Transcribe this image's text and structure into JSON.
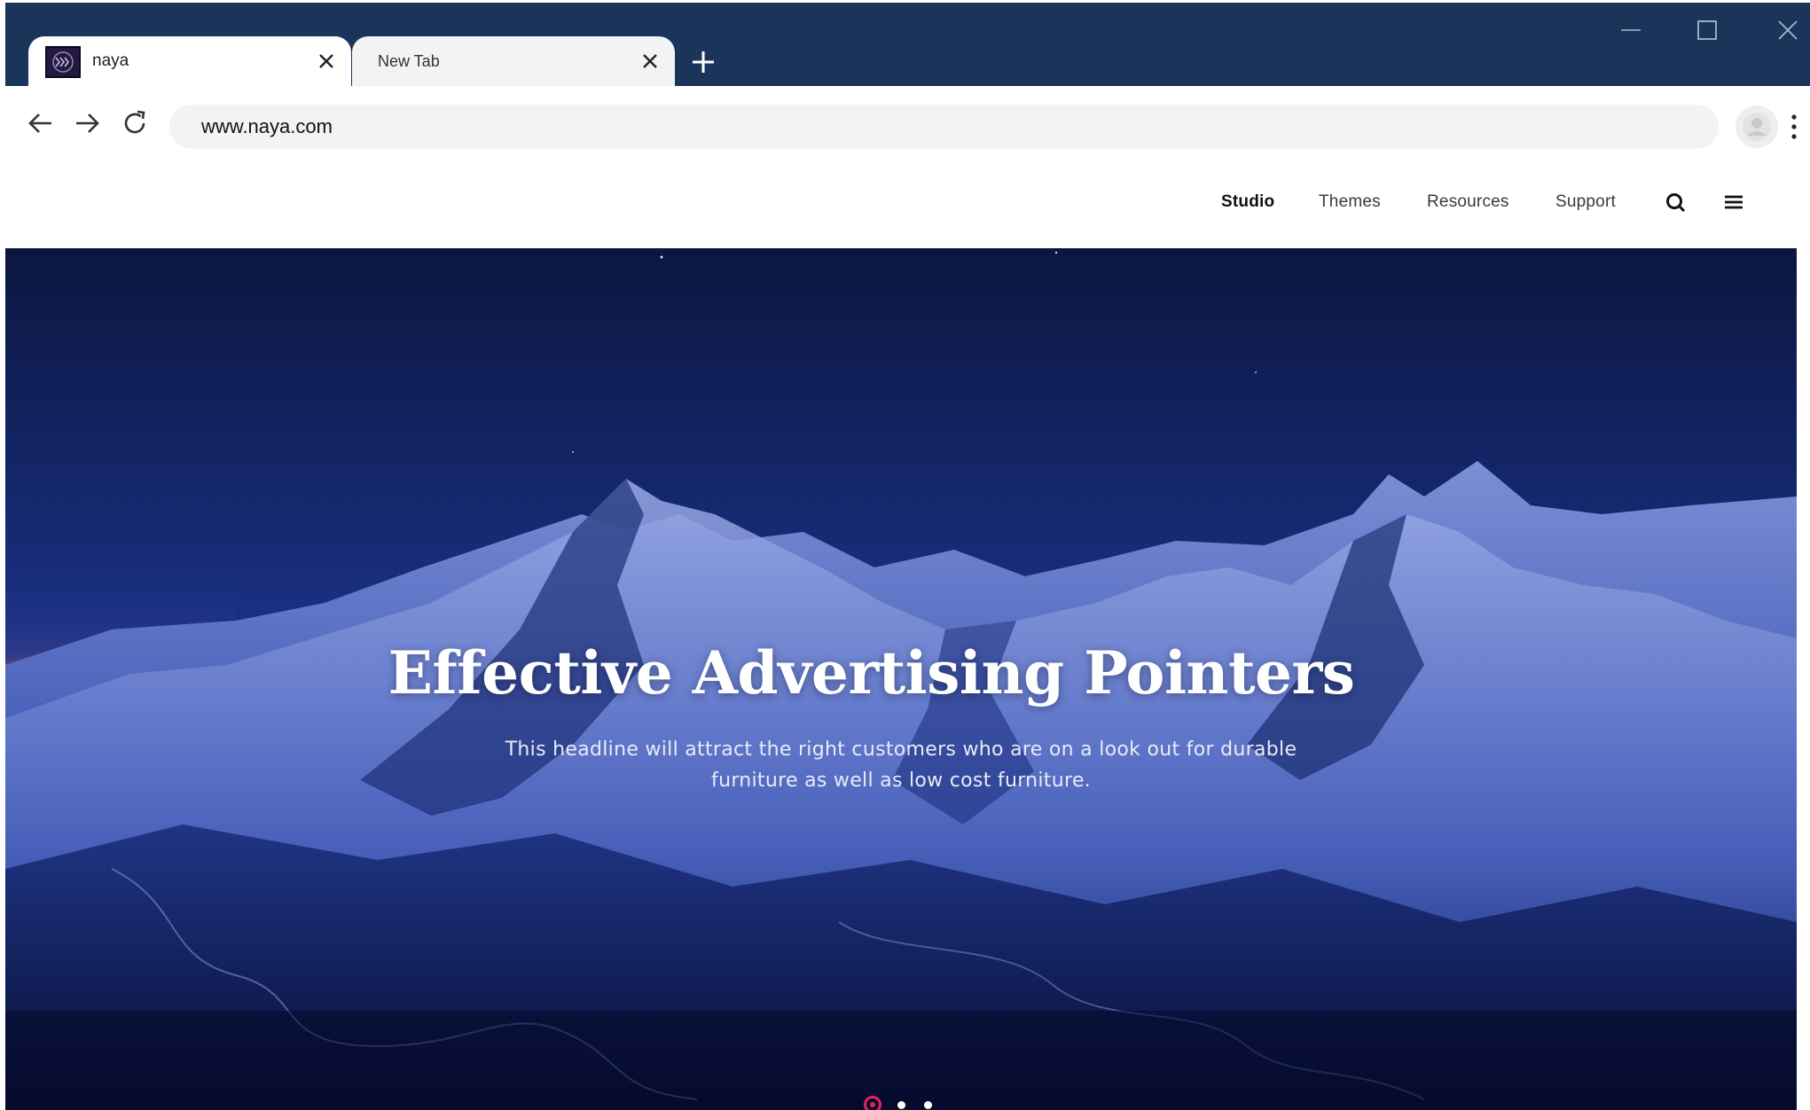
{
  "browser": {
    "tabs": [
      {
        "title": "naya",
        "active": true,
        "icon": "naya-logo-icon"
      },
      {
        "title": "New Tab",
        "active": false
      }
    ],
    "address_bar": {
      "url": "www.naya.com"
    },
    "controls": [
      "back-icon",
      "forward-icon",
      "reload-icon",
      "profile-icon",
      "more-icon"
    ]
  },
  "site": {
    "nav": {
      "studio": "Studio",
      "themes": "Themes",
      "resources": "Resources",
      "support": "Support"
    },
    "hero": {
      "title": "Effective Advertising Pointers",
      "subtitle": "This headline will attract the right customers who are on a look out for durable furniture as well as low cost furniture.",
      "slides_total": 3,
      "active_slide": 1
    }
  },
  "colors": {
    "titlebar": "#1a3559",
    "hero_accent": "#e2245b",
    "hero_sky": "#15286e"
  }
}
